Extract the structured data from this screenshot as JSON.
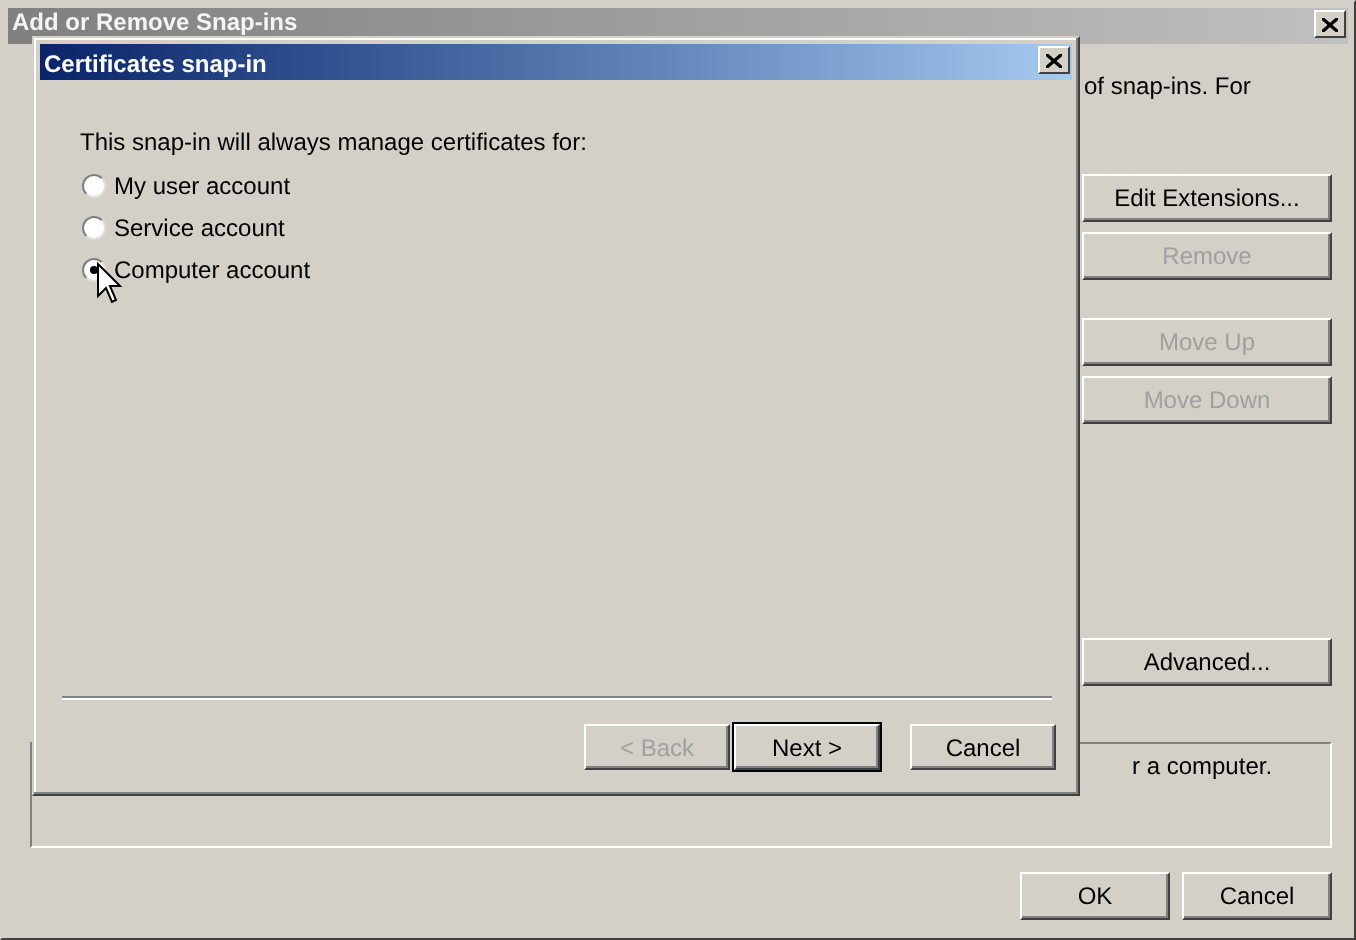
{
  "main_window": {
    "title": "Add or Remove Snap-ins",
    "active": false,
    "intro_text": "of snap-ins. For",
    "side_buttons": [
      {
        "label": "Edit Extensions...",
        "disabled": false
      },
      {
        "label": "Remove",
        "disabled": true
      },
      {
        "label": "Move Up",
        "disabled": true
      },
      {
        "label": "Move Down",
        "disabled": true
      },
      {
        "label": "Advanced...",
        "disabled": false
      }
    ],
    "description": "r a computer.",
    "footer_buttons": [
      {
        "label": "OK",
        "disabled": false
      },
      {
        "label": "Cancel",
        "disabled": false
      }
    ]
  },
  "dialog": {
    "title": "Certificates snap-in",
    "active": true,
    "prompt": "This snap-in will always manage certificates for:",
    "options": [
      {
        "label": "My user account",
        "selected": false
      },
      {
        "label": "Service account",
        "selected": false
      },
      {
        "label": "Computer account",
        "selected": true
      }
    ],
    "buttons": [
      {
        "label": "< Back",
        "disabled": true,
        "default": false
      },
      {
        "label": "Next >",
        "disabled": false,
        "default": true
      },
      {
        "label": "Cancel",
        "disabled": false,
        "default": false
      }
    ]
  }
}
